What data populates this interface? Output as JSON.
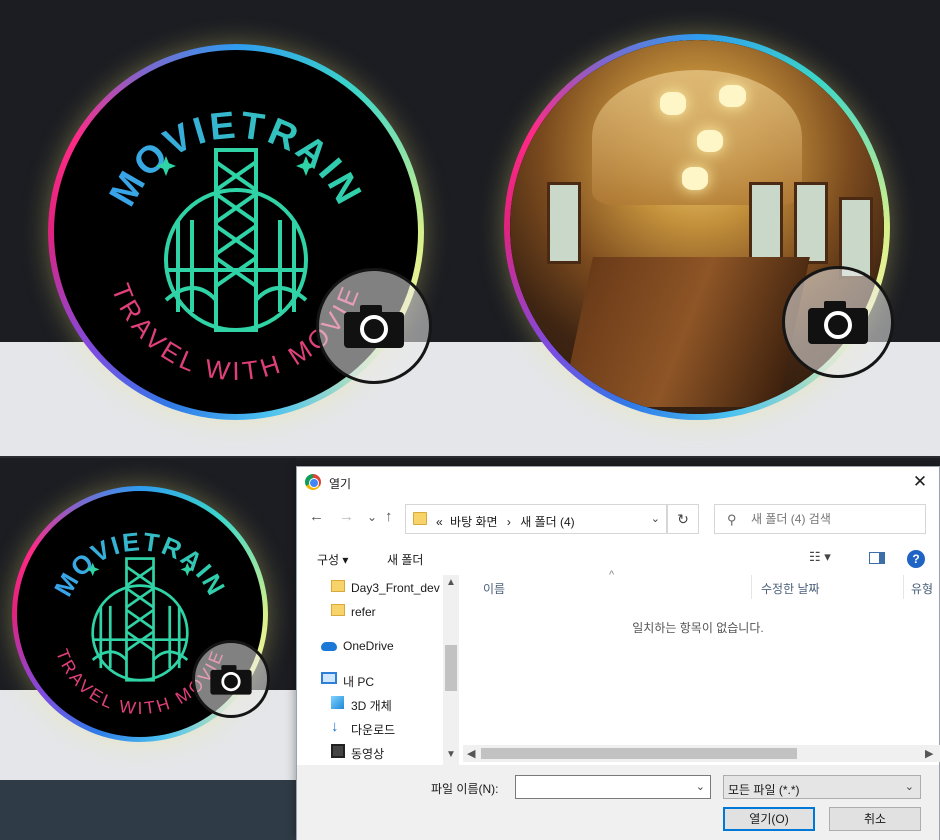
{
  "logo": {
    "top_text": "MOVIETRAIN",
    "bottom_text": "TRAVEL WITH MOVIE"
  },
  "colors": {
    "logo_teal": "#2fd3a5",
    "logo_blue": "#3aa0ee",
    "logo_pink": "#e0407a",
    "dialog_accent": "#0078d7"
  },
  "icons": {
    "camera": "camera-icon"
  },
  "dialog": {
    "title": "열기",
    "close_glyph": "✕",
    "nav": {
      "back": "←",
      "forward": "→",
      "recent": "⌄",
      "up": "↑"
    },
    "address": {
      "prefix": "«",
      "crumb1": "바탕 화면",
      "sep": "›",
      "crumb2": "새 폴더 (4)",
      "dropdown": "⌄"
    },
    "refresh_glyph": "↻",
    "search_placeholder": "새 폴더 (4) 검색",
    "search_glyph": "⚲",
    "toolbar": {
      "organize": "구성 ▾",
      "new_folder": "새 폴더",
      "view_glyph": "☷ ▾",
      "help": "?"
    },
    "nav_pane": [
      {
        "label": "Day3_Front_dev",
        "icon": "folder"
      },
      {
        "label": "refer",
        "icon": "folder"
      },
      {
        "label": "OneDrive",
        "icon": "cloud"
      },
      {
        "label": "내 PC",
        "icon": "pc"
      },
      {
        "label": "3D 개체",
        "icon": "3d"
      },
      {
        "label": "다운로드",
        "icon": "download"
      },
      {
        "label": "동영상",
        "icon": "video"
      }
    ],
    "columns": {
      "name": "이름",
      "modified": "수정한 날짜",
      "type": "유형"
    },
    "empty_message": "일치하는 항목이 없습니다.",
    "file_name_label": "파일 이름(N):",
    "file_name_value": "",
    "file_type": "모든 파일 (*.*)",
    "open_button": "열기(O)",
    "cancel_button": "취소"
  }
}
